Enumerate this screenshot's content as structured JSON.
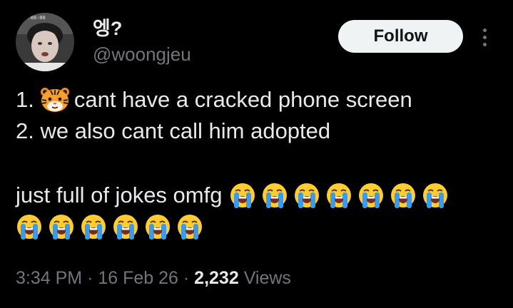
{
  "author": {
    "display_name": "엥?",
    "handle": "@woongjeu",
    "avatar_label": "00:00:00"
  },
  "actions": {
    "follow_label": "Follow",
    "more_icon": "more-vertical-icon"
  },
  "tweet": {
    "line1_prefix": "1.",
    "line1_emoji": "tiger-face",
    "line1_text": "cant have a cracked phone screen",
    "line2_text": "2. we also cant call him adopted",
    "line3_text": "just full of jokes omfg",
    "crying_emoji_count_line3": 7,
    "crying_emoji_count_line4": 6
  },
  "meta": {
    "time": "3:34 PM",
    "separator": "·",
    "date": "16 Feb 26",
    "views_count": "2,232",
    "views_label": "Views"
  },
  "colors": {
    "background": "#000000",
    "text": "#e7e9ea",
    "muted": "#71767b",
    "button_bg": "#eff3f4"
  }
}
